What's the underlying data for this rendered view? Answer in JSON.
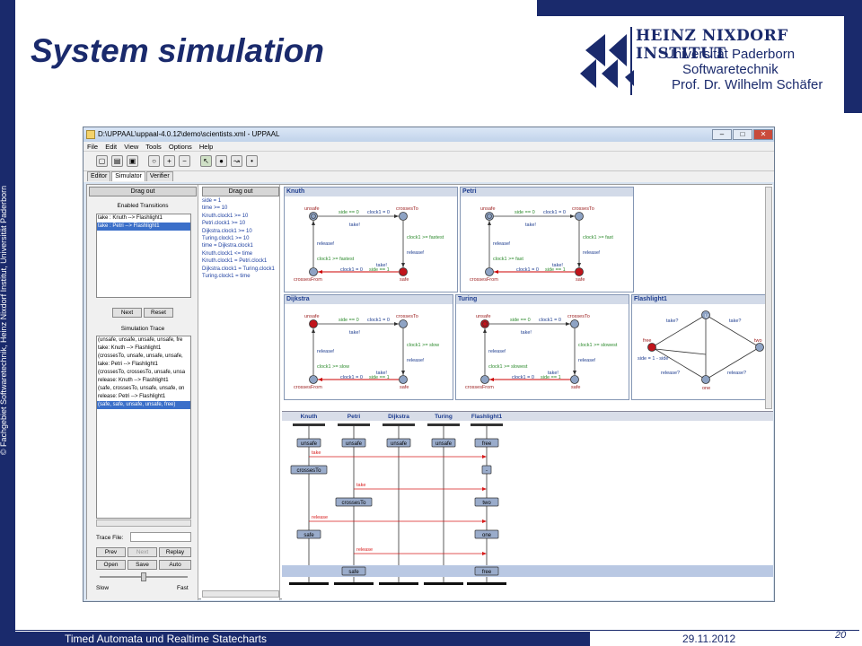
{
  "slide": {
    "title": "System simulation",
    "side_text": "© Fachgebiet Softwaretechnik, Heinz Nixdorf Institut, Universität Paderborn",
    "footer_left": "Timed Automata und Realtime Statecharts",
    "footer_date": "29.11.2012",
    "page_number": "20",
    "logo": {
      "line1": "HEINZ NIXDORF INSTITUT",
      "line2": "Universität Paderborn",
      "line3": "Softwaretechnik",
      "line4": "Prof. Dr. Wilhelm Schäfer"
    },
    "colors": {
      "brand": "#1a2a6c"
    }
  },
  "uppaal": {
    "window_title": "D:\\UPPAAL\\uppaal-4.0.12\\demo\\scientists.xml - UPPAAL",
    "menu": [
      "File",
      "Edit",
      "View",
      "Tools",
      "Options",
      "Help"
    ],
    "tabs": [
      "Editor",
      "Simulator",
      "Verifier"
    ],
    "active_tab": "Simulator",
    "drag_out": "Drag out",
    "enabled_transitions_label": "Enabled Transitions",
    "enabled_transitions": [
      "take : Knuth --> Flashlight1",
      "take : Petri --> Flashlight1"
    ],
    "selected_transition": 1,
    "next_label": "Next",
    "reset_label": "Reset",
    "trace_label": "Simulation Trace",
    "trace": [
      "(unsafe, unsafe, unsafe, unsafe, fre",
      "take: Knuth --> Flashlight1",
      "(crossesTo, unsafe, unsafe, unsafe,",
      "take: Petri --> Flashlight1",
      "(crossesTo, crossesTo, unsafe, unsa",
      "release: Knuth --> Flashlight1",
      "(safe, crossesTo, unsafe, unsafe, on",
      "release: Petri --> Flashlight1",
      "(safe, safe, unsafe, unsafe, free)"
    ],
    "selected_trace": 8,
    "trace_file_label": "Trace File:",
    "prev_label": "Prev",
    "next2_label": "Next",
    "replay_label": "Replay",
    "open_label": "Open",
    "save_label": "Save",
    "auto_label": "Auto",
    "slow_label": "Slow",
    "fast_label": "Fast",
    "speed_level": 0.5,
    "variables": [
      "side = 1",
      "time >= 10",
      "Knuth.clock1 >= 10",
      "Petri.clock1 >= 10",
      "Dijkstra.clock1 >= 10",
      "Turing.clock1 >= 10",
      "time = Dijkstra.clock1",
      "Knuth.clock1 <= time",
      "Knuth.clock1 = Petri.clock1",
      "Dijkstra.clock1 = Turing.clock1",
      "Turing.clock1 = time"
    ],
    "processes": [
      {
        "name": "Knuth",
        "speed": "fastest"
      },
      {
        "name": "Petri",
        "speed": "fast"
      },
      {
        "name": "Dijkstra",
        "speed": "slow"
      },
      {
        "name": "Turing",
        "speed": "slowest"
      }
    ],
    "automaton_labels": {
      "unsafe": "unsafe",
      "crossesTo": "crossesTo",
      "crossesFrom": "crossesFrom",
      "safe": "safe",
      "guard_top": "side == 0",
      "reset_top": "clock1 = 0",
      "take": "take!",
      "release": "release!",
      "clock_prefix": "clock1 >= ",
      "guard_bottom": "side == 1",
      "reset_bottom": "clock1 = 0"
    },
    "flashlight": {
      "name": "Flashlight1",
      "free": "free",
      "two": "two",
      "one": "one",
      "take": "take?",
      "release": "release?",
      "side_update": "side = 1 - side"
    },
    "msc": {
      "columns": [
        "Knuth",
        "Petri",
        "Dijkstra",
        "Turing",
        "Flashlight1"
      ],
      "initial_states": [
        "unsafe",
        "unsafe",
        "unsafe",
        "unsafe",
        "free"
      ],
      "messages": [
        "take",
        "take",
        "release",
        "release"
      ],
      "states": {
        "crossesTo": "crossesTo",
        "dash": "-",
        "two": "two",
        "safe": "safe",
        "one": "one",
        "free": "free"
      }
    }
  }
}
